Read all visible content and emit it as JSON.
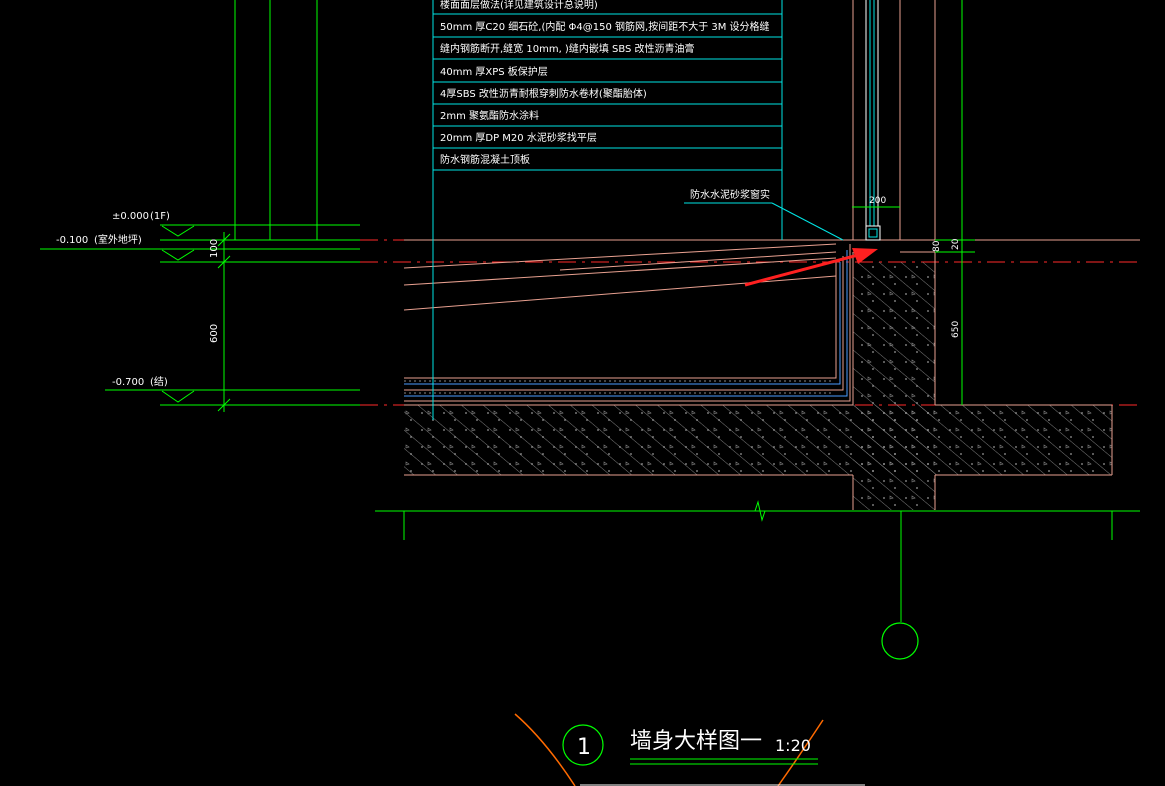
{
  "layer_notes": [
    "楼面面层做法(详见建筑设计总说明)",
    "50mm 厚C20 细石砼,(内配 Φ4@150 钢筋网,按间距不大于 3M 设分格缝",
    "缝内钢筋断开,缝宽 10mm, )缝内嵌填 SBS 改性沥青油膏",
    "40mm 厚XPS 板保护层",
    "4厚SBS 改性沥青耐根穿刺防水卷材(聚酯胎体)",
    "2mm 聚氨酯防水涂料",
    "20mm 厚DP M20 水泥砂浆找平层",
    "防水钢筋混凝土顶板"
  ],
  "callout_text": "防水水泥砂浆窗实",
  "elevations": [
    {
      "value": "±0.000",
      "note": "(1F)"
    },
    {
      "value": "-0.100",
      "note": "(室外地坪)"
    },
    {
      "value": "-0.700",
      "note": "(结)"
    }
  ],
  "dimensions": {
    "d100": "100",
    "d600": "600",
    "d200": "200",
    "d80": "80",
    "d20": "20",
    "d650": "650"
  },
  "axis_bubble": "",
  "title_block": {
    "number": "1",
    "title": "墙身大样图一",
    "scale": "1:20"
  },
  "colors": {
    "background": "#000000",
    "structure": "#e8a090",
    "dimension": "#00ff00",
    "annotation": "#00e5e5",
    "text": "#ffffff",
    "centerline": "#ff2a2a",
    "arrow": "#ff2020",
    "hatch": "#8a8a8a",
    "membrane": "#4a9cff",
    "title_arc": "#ff6a00"
  }
}
